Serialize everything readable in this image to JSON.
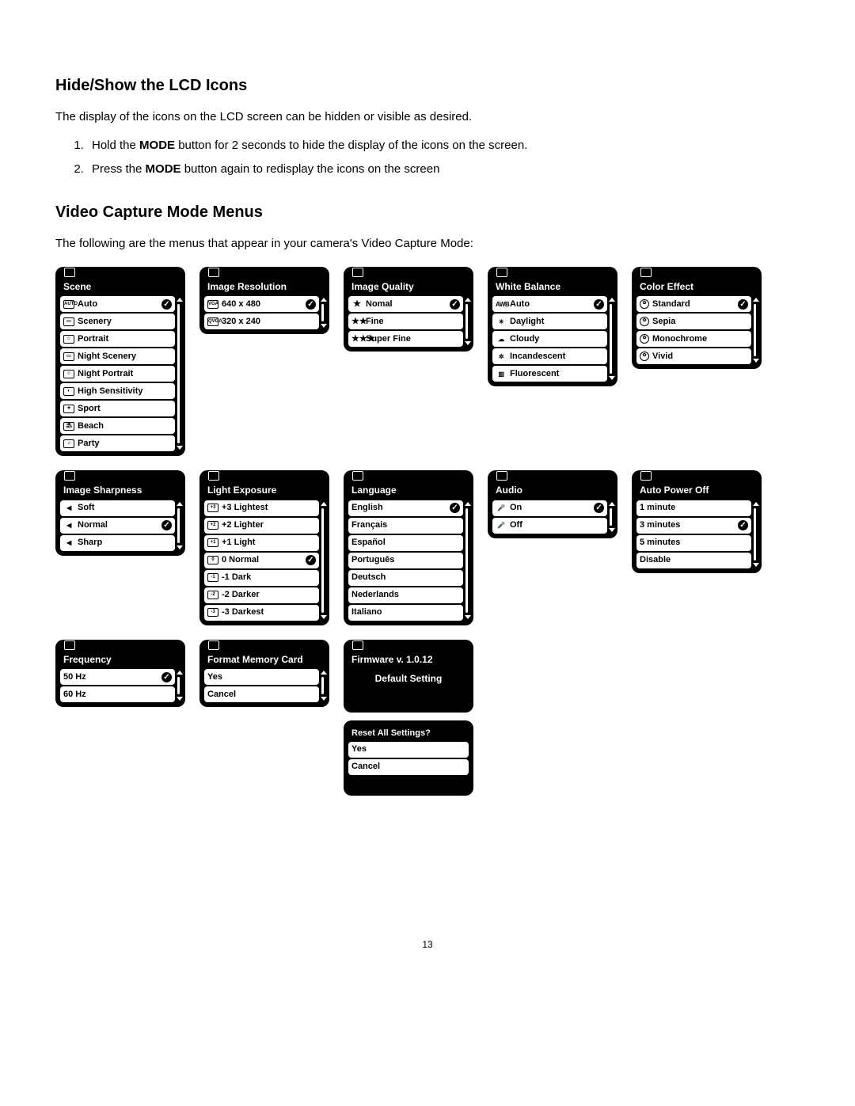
{
  "section1": {
    "heading": "Hide/Show the LCD Icons",
    "intro": "The display of the icons on the LCD screen can be hidden or visible as desired.",
    "step1_a": "Hold the ",
    "step1_bold": "MODE",
    "step1_b": " button for 2 seconds to hide the display of the icons on the screen.",
    "step2_a": "Press the ",
    "step2_bold": "MODE",
    "step2_b": " button again to redisplay the icons on the screen"
  },
  "section2": {
    "heading": "Video Capture Mode Menus",
    "intro": "The following are the menus that appear in your camera's Video Capture Mode:"
  },
  "menus": {
    "scene": {
      "title": "Scene",
      "items": [
        {
          "icon": "AUTO",
          "label": "Auto",
          "checked": true
        },
        {
          "icon": "▭",
          "label": "Scenery"
        },
        {
          "icon": "☺",
          "label": "Portrait"
        },
        {
          "icon": "▭",
          "label": "Night Scenery"
        },
        {
          "icon": "☺",
          "label": "Night Portrait"
        },
        {
          "icon": "◐",
          "label": "High Sensitivity"
        },
        {
          "icon": "✦",
          "label": "Sport"
        },
        {
          "icon": "⛱",
          "label": "Beach"
        },
        {
          "icon": "♫",
          "label": "Party"
        }
      ]
    },
    "resolution": {
      "title": "Image Resolution",
      "items": [
        {
          "icon": "VGA",
          "label": "640 x 480",
          "checked": true
        },
        {
          "icon": "QVGA",
          "label": "320 x 240"
        }
      ]
    },
    "quality": {
      "title": "Image Quality",
      "items": [
        {
          "icon": "★",
          "label": "Nomal",
          "checked": true
        },
        {
          "icon": "★★",
          "label": "Fine"
        },
        {
          "icon": "★★★",
          "label": "Super Fine"
        }
      ]
    },
    "wb": {
      "title": "White Balance",
      "items": [
        {
          "icon": "AWB",
          "label": "Auto",
          "checked": true
        },
        {
          "icon": "☀",
          "label": "Daylight"
        },
        {
          "icon": "☁",
          "label": "Cloudy"
        },
        {
          "icon": "✲",
          "label": "Incandescent"
        },
        {
          "icon": "▥",
          "label": "Fluorescent"
        }
      ]
    },
    "color": {
      "title": "Color Effect",
      "items": [
        {
          "icon": "✿",
          "label": "Standard",
          "checked": true
        },
        {
          "icon": "✿",
          "label": "Sepia"
        },
        {
          "icon": "✿",
          "label": "Monochrome"
        },
        {
          "icon": "✿",
          "label": "Vivid"
        }
      ]
    },
    "sharpness": {
      "title": "Image Sharpness",
      "items": [
        {
          "icon": "◀",
          "label": "Soft"
        },
        {
          "icon": "◀",
          "label": "Normal",
          "checked": true
        },
        {
          "icon": "◀",
          "label": "Sharp"
        }
      ]
    },
    "exposure": {
      "title": "Light Exposure",
      "items": [
        {
          "icon": "+3",
          "label": "+3 Lightest"
        },
        {
          "icon": "+2",
          "label": "+2 Lighter"
        },
        {
          "icon": "+1",
          "label": "+1 Light"
        },
        {
          "icon": "0",
          "label": "0 Normal",
          "checked": true
        },
        {
          "icon": "-1",
          "label": "-1 Dark"
        },
        {
          "icon": "-2",
          "label": "-2 Darker"
        },
        {
          "icon": "-3",
          "label": "-3 Darkest"
        }
      ]
    },
    "language": {
      "title": "Language",
      "items": [
        {
          "label": "English",
          "checked": true
        },
        {
          "label": "Français"
        },
        {
          "label": "Español"
        },
        {
          "label": "Português"
        },
        {
          "label": "Deutsch"
        },
        {
          "label": "Nederlands"
        },
        {
          "label": "Italiano"
        }
      ]
    },
    "audio": {
      "title": "Audio",
      "items": [
        {
          "icon": "🎤",
          "label": "On",
          "checked": true
        },
        {
          "icon": "🎤",
          "label": "Off"
        }
      ]
    },
    "autopower": {
      "title": "Auto Power Off",
      "items": [
        {
          "label": "1 minute"
        },
        {
          "label": "3 minutes",
          "checked": true
        },
        {
          "label": "5 minutes"
        },
        {
          "label": "Disable"
        }
      ]
    },
    "frequency": {
      "title": "Frequency",
      "items": [
        {
          "label": "50 Hz",
          "checked": true
        },
        {
          "label": "60 Hz"
        }
      ]
    },
    "format": {
      "title": "Format Memory Card",
      "items": [
        {
          "label": "Yes"
        },
        {
          "label": "Cancel"
        }
      ]
    },
    "firmware": {
      "title": "Firmware v. 1.0.12",
      "default_label": "Default Setting",
      "reset_title": "Reset All Settings?",
      "items": [
        {
          "label": "Yes"
        },
        {
          "label": "Cancel"
        }
      ]
    }
  },
  "page_number": "13"
}
